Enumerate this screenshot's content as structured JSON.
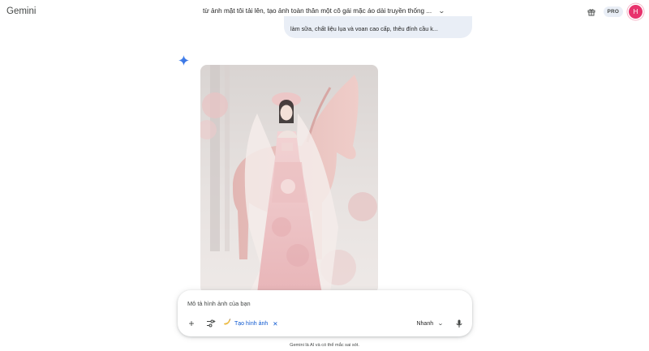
{
  "header": {
    "brand": "Gemini",
    "conversation_title": "từ ảnh mặt tôi tải lên, tạo ảnh toàn thân một cô gái mặc áo dài truyền thống ...",
    "pro_badge": "PRO",
    "avatar_initial": "H"
  },
  "conversation": {
    "user_message_tail": "làm sữa, chất liệu lụa và voan cao cấp, thêu đính cầu k...",
    "response_image": "generated-image-woman-in-pink-ao-dai-with-horse"
  },
  "composer": {
    "placeholder": "Mô tả hình ảnh của bạn",
    "tool_chip_label": "Tạo hình ảnh",
    "mode_label": "Nhanh"
  },
  "footer": {
    "disclaimer": "Gemini là AI và có thể mắc sai sót."
  },
  "colors": {
    "accent_blue": "#0b57d0",
    "bubble_bg": "#e9eef6",
    "avatar_bg": "#e8336d"
  },
  "icons": [
    "caret-down-icon",
    "gift-icon",
    "sparkle-icon",
    "plus-icon",
    "tools-icon",
    "banana-icon",
    "close-icon",
    "microphone-icon"
  ]
}
